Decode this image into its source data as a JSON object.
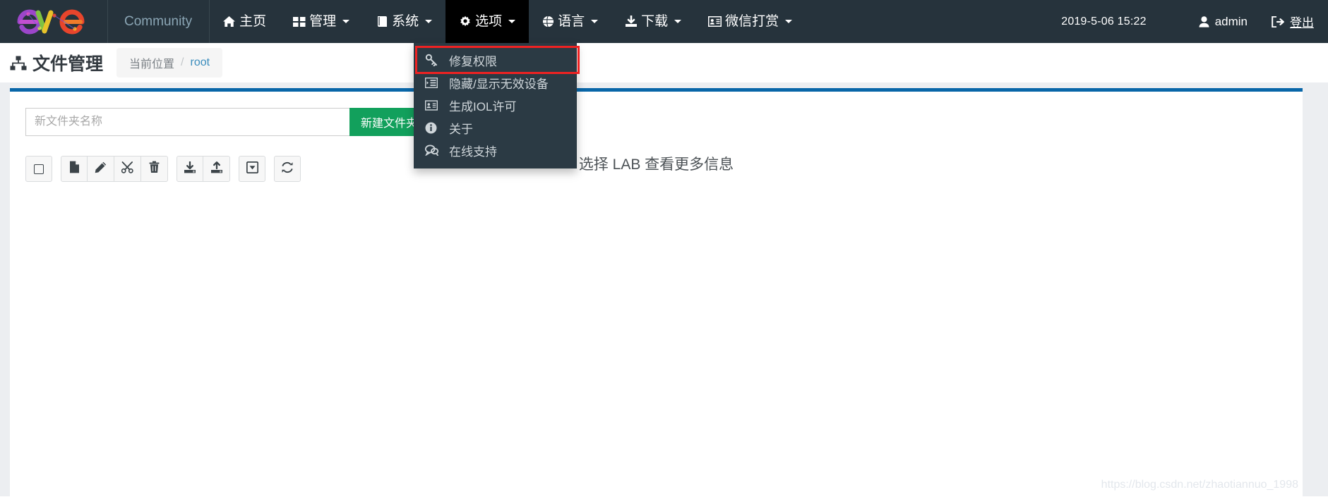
{
  "navbar": {
    "brand_alt": "eve-ng-logo",
    "items": [
      {
        "label": "Community",
        "icon": "",
        "caret": false,
        "active": false,
        "muted": true
      },
      {
        "label": "主页",
        "icon": "home-icon",
        "caret": false,
        "active": false,
        "muted": false
      },
      {
        "label": "管理",
        "icon": "grid-icon",
        "caret": true,
        "active": false,
        "muted": false
      },
      {
        "label": "系统",
        "icon": "book-icon",
        "caret": true,
        "active": false,
        "muted": false
      },
      {
        "label": "选项",
        "icon": "gear-icon",
        "caret": true,
        "active": true,
        "muted": false
      },
      {
        "label": "语言",
        "icon": "globe-icon",
        "caret": true,
        "active": false,
        "muted": false
      },
      {
        "label": "下载",
        "icon": "download-icon",
        "caret": true,
        "active": false,
        "muted": false
      },
      {
        "label": "微信打赏",
        "icon": "id-card-icon",
        "caret": true,
        "active": false,
        "muted": false
      }
    ],
    "clock": "2019-5-06  15:22",
    "user": "admin",
    "logout": "登出"
  },
  "dropdown": {
    "open_for": "选项",
    "items": [
      {
        "label": "修复权限",
        "icon": "wrench-icon",
        "highlighted": true
      },
      {
        "label": "隐藏/显示无效设备",
        "icon": "list-indent-icon",
        "highlighted": false
      },
      {
        "label": "生成IOL许可",
        "icon": "id-card-icon",
        "highlighted": false
      },
      {
        "label": "关于",
        "icon": "info-icon",
        "highlighted": false
      },
      {
        "label": "在线支持",
        "icon": "chat-icon",
        "highlighted": false
      }
    ]
  },
  "subheader": {
    "title": "文件管理",
    "title_icon": "sitemap-icon",
    "breadcrumb_label": "当前位置",
    "breadcrumb_separator": "/",
    "breadcrumb_current": "root"
  },
  "main": {
    "new_folder_placeholder": "新文件夹名称",
    "new_folder_value": "",
    "new_folder_button": "新建文件夹",
    "toolbar": [
      {
        "name": "select-all-checkbox",
        "icon": "checkbox-icon"
      },
      {
        "name": "new-file-button",
        "icon": "file-icon"
      },
      {
        "name": "edit-button",
        "icon": "pencil-icon"
      },
      {
        "name": "cut-button",
        "icon": "scissors-icon"
      },
      {
        "name": "delete-button",
        "icon": "trash-icon"
      },
      {
        "name": "download-button",
        "icon": "download-tray-icon"
      },
      {
        "name": "upload-button",
        "icon": "upload-tray-icon"
      },
      {
        "name": "export-button",
        "icon": "boxed-arrow-down-icon"
      },
      {
        "name": "refresh-button",
        "icon": "refresh-icon"
      }
    ],
    "center_hint": "选择 LAB 查看更多信息"
  },
  "watermark": "https://blog.csdn.net/zhaotiannuo_1998",
  "colors": {
    "navbar_bg": "#26333c",
    "navbar_active_bg": "#000000",
    "dropdown_bg": "#2b3a44",
    "panel_accent": "#0866a8",
    "primary_green": "#12a05c",
    "highlight_red": "#ee2222",
    "link_blue": "#3b8dbd",
    "body_bg": "#eceef1"
  }
}
